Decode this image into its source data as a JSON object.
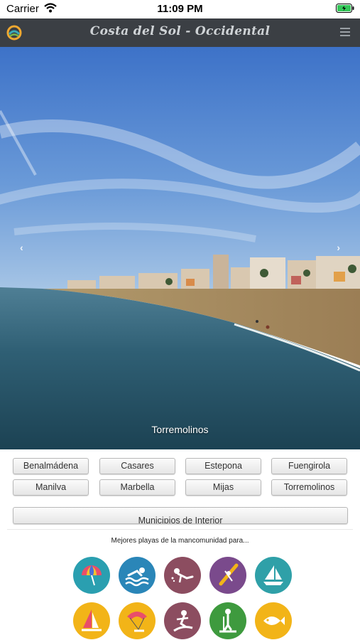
{
  "status_bar": {
    "carrier": "Carrier",
    "time": "11:09 PM"
  },
  "header": {
    "title": "Costa del Sol - Occidental"
  },
  "hero": {
    "caption": "Torremolinos",
    "prev_arrow": "‹",
    "next_arrow": "›"
  },
  "municipalities": [
    "Benalmádena",
    "Casares",
    "Estepona",
    "Fuengirola",
    "Manilva",
    "Marbella",
    "Mijas",
    "Torremolinos"
  ],
  "interior_button": "Municipios de Interior",
  "beaches_label": "Mejores playas de la mancomunidad para...",
  "activities": [
    {
      "icon": "beach-umbrella-icon",
      "color": "#2a9fb0"
    },
    {
      "icon": "swimming-icon",
      "color": "#2a86b8"
    },
    {
      "icon": "diving-icon",
      "color": "#8c4d60"
    },
    {
      "icon": "kayak-icon",
      "color": "#7a4a8c"
    },
    {
      "icon": "sailboat-icon",
      "color": "#2fa0a8"
    },
    {
      "icon": "windsurf-icon",
      "color": "#f2b418"
    },
    {
      "icon": "kitesurf-icon",
      "color": "#f2b418"
    },
    {
      "icon": "surf-icon",
      "color": "#8c4d60"
    },
    {
      "icon": "paddle-board-icon",
      "color": "#3e9a3e"
    },
    {
      "icon": "fishing-icon",
      "color": "#f2b418"
    }
  ]
}
